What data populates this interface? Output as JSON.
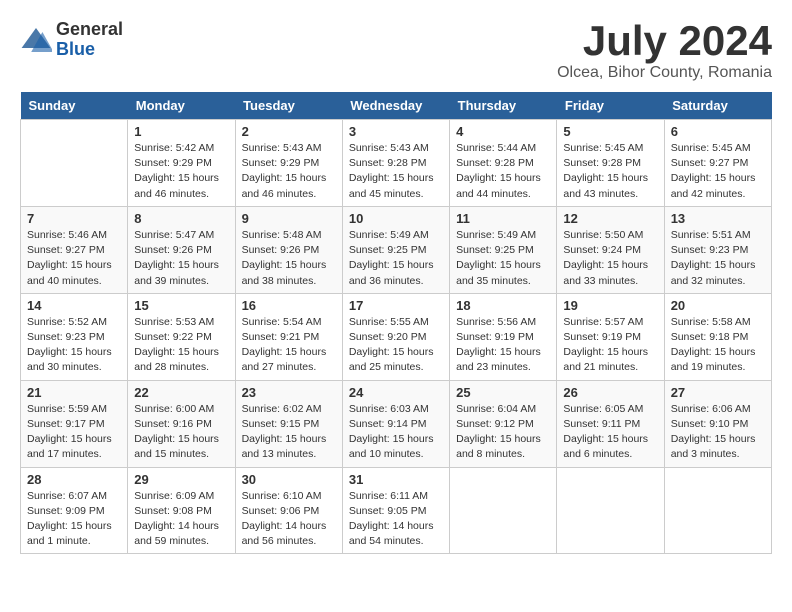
{
  "header": {
    "logo_general": "General",
    "logo_blue": "Blue",
    "main_title": "July 2024",
    "subtitle": "Olcea, Bihor County, Romania"
  },
  "calendar": {
    "days_of_week": [
      "Sunday",
      "Monday",
      "Tuesday",
      "Wednesday",
      "Thursday",
      "Friday",
      "Saturday"
    ],
    "weeks": [
      [
        {
          "day": "",
          "info": ""
        },
        {
          "day": "1",
          "info": "Sunrise: 5:42 AM\nSunset: 9:29 PM\nDaylight: 15 hours\nand 46 minutes."
        },
        {
          "day": "2",
          "info": "Sunrise: 5:43 AM\nSunset: 9:29 PM\nDaylight: 15 hours\nand 46 minutes."
        },
        {
          "day": "3",
          "info": "Sunrise: 5:43 AM\nSunset: 9:28 PM\nDaylight: 15 hours\nand 45 minutes."
        },
        {
          "day": "4",
          "info": "Sunrise: 5:44 AM\nSunset: 9:28 PM\nDaylight: 15 hours\nand 44 minutes."
        },
        {
          "day": "5",
          "info": "Sunrise: 5:45 AM\nSunset: 9:28 PM\nDaylight: 15 hours\nand 43 minutes."
        },
        {
          "day": "6",
          "info": "Sunrise: 5:45 AM\nSunset: 9:27 PM\nDaylight: 15 hours\nand 42 minutes."
        }
      ],
      [
        {
          "day": "7",
          "info": "Sunrise: 5:46 AM\nSunset: 9:27 PM\nDaylight: 15 hours\nand 40 minutes."
        },
        {
          "day": "8",
          "info": "Sunrise: 5:47 AM\nSunset: 9:26 PM\nDaylight: 15 hours\nand 39 minutes."
        },
        {
          "day": "9",
          "info": "Sunrise: 5:48 AM\nSunset: 9:26 PM\nDaylight: 15 hours\nand 38 minutes."
        },
        {
          "day": "10",
          "info": "Sunrise: 5:49 AM\nSunset: 9:25 PM\nDaylight: 15 hours\nand 36 minutes."
        },
        {
          "day": "11",
          "info": "Sunrise: 5:49 AM\nSunset: 9:25 PM\nDaylight: 15 hours\nand 35 minutes."
        },
        {
          "day": "12",
          "info": "Sunrise: 5:50 AM\nSunset: 9:24 PM\nDaylight: 15 hours\nand 33 minutes."
        },
        {
          "day": "13",
          "info": "Sunrise: 5:51 AM\nSunset: 9:23 PM\nDaylight: 15 hours\nand 32 minutes."
        }
      ],
      [
        {
          "day": "14",
          "info": "Sunrise: 5:52 AM\nSunset: 9:23 PM\nDaylight: 15 hours\nand 30 minutes."
        },
        {
          "day": "15",
          "info": "Sunrise: 5:53 AM\nSunset: 9:22 PM\nDaylight: 15 hours\nand 28 minutes."
        },
        {
          "day": "16",
          "info": "Sunrise: 5:54 AM\nSunset: 9:21 PM\nDaylight: 15 hours\nand 27 minutes."
        },
        {
          "day": "17",
          "info": "Sunrise: 5:55 AM\nSunset: 9:20 PM\nDaylight: 15 hours\nand 25 minutes."
        },
        {
          "day": "18",
          "info": "Sunrise: 5:56 AM\nSunset: 9:19 PM\nDaylight: 15 hours\nand 23 minutes."
        },
        {
          "day": "19",
          "info": "Sunrise: 5:57 AM\nSunset: 9:19 PM\nDaylight: 15 hours\nand 21 minutes."
        },
        {
          "day": "20",
          "info": "Sunrise: 5:58 AM\nSunset: 9:18 PM\nDaylight: 15 hours\nand 19 minutes."
        }
      ],
      [
        {
          "day": "21",
          "info": "Sunrise: 5:59 AM\nSunset: 9:17 PM\nDaylight: 15 hours\nand 17 minutes."
        },
        {
          "day": "22",
          "info": "Sunrise: 6:00 AM\nSunset: 9:16 PM\nDaylight: 15 hours\nand 15 minutes."
        },
        {
          "day": "23",
          "info": "Sunrise: 6:02 AM\nSunset: 9:15 PM\nDaylight: 15 hours\nand 13 minutes."
        },
        {
          "day": "24",
          "info": "Sunrise: 6:03 AM\nSunset: 9:14 PM\nDaylight: 15 hours\nand 10 minutes."
        },
        {
          "day": "25",
          "info": "Sunrise: 6:04 AM\nSunset: 9:12 PM\nDaylight: 15 hours\nand 8 minutes."
        },
        {
          "day": "26",
          "info": "Sunrise: 6:05 AM\nSunset: 9:11 PM\nDaylight: 15 hours\nand 6 minutes."
        },
        {
          "day": "27",
          "info": "Sunrise: 6:06 AM\nSunset: 9:10 PM\nDaylight: 15 hours\nand 3 minutes."
        }
      ],
      [
        {
          "day": "28",
          "info": "Sunrise: 6:07 AM\nSunset: 9:09 PM\nDaylight: 15 hours\nand 1 minute."
        },
        {
          "day": "29",
          "info": "Sunrise: 6:09 AM\nSunset: 9:08 PM\nDaylight: 14 hours\nand 59 minutes."
        },
        {
          "day": "30",
          "info": "Sunrise: 6:10 AM\nSunset: 9:06 PM\nDaylight: 14 hours\nand 56 minutes."
        },
        {
          "day": "31",
          "info": "Sunrise: 6:11 AM\nSunset: 9:05 PM\nDaylight: 14 hours\nand 54 minutes."
        },
        {
          "day": "",
          "info": ""
        },
        {
          "day": "",
          "info": ""
        },
        {
          "day": "",
          "info": ""
        }
      ]
    ]
  }
}
